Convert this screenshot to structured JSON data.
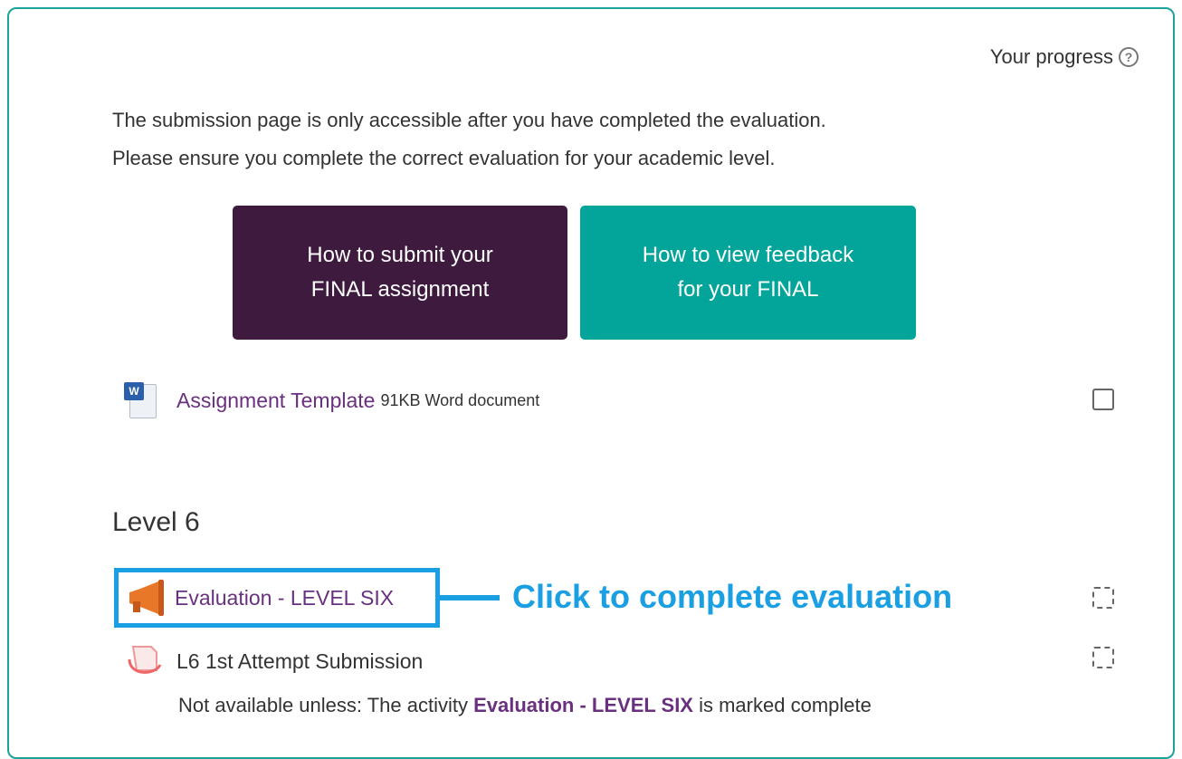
{
  "progress": {
    "label": "Your progress",
    "help_glyph": "?"
  },
  "intro": {
    "line1": "The submission page is only accessible after you have completed the evaluation.",
    "line2": "Please ensure you complete the correct evaluation for your academic level."
  },
  "buttons": {
    "submit": {
      "line1": "How to submit your",
      "line2": "FINAL assignment"
    },
    "feedback": {
      "line1": "How to view feedback",
      "line2": "for your FINAL"
    }
  },
  "template": {
    "title": "Assignment Template",
    "meta": "91KB Word document",
    "icon": "word-document-icon",
    "icon_glyph": "W"
  },
  "section": {
    "title": "Level 6",
    "evaluation": {
      "title": "Evaluation - LEVEL SIX",
      "icon": "feedback-megaphone-icon"
    },
    "callout": "Click to complete evaluation",
    "submission": {
      "title": "L6 1st Attempt Submission",
      "icon": "assignment-icon"
    },
    "restriction": {
      "prefix": "Not available unless: The activity",
      "activity": "Evaluation - LEVEL SIX",
      "suffix": "is marked complete"
    }
  },
  "colors": {
    "frame": "#1aa39a",
    "submit_button": "#3d1a3e",
    "feedback_button": "#03a49a",
    "link": "#6a3080",
    "callout": "#1a9fe3"
  }
}
